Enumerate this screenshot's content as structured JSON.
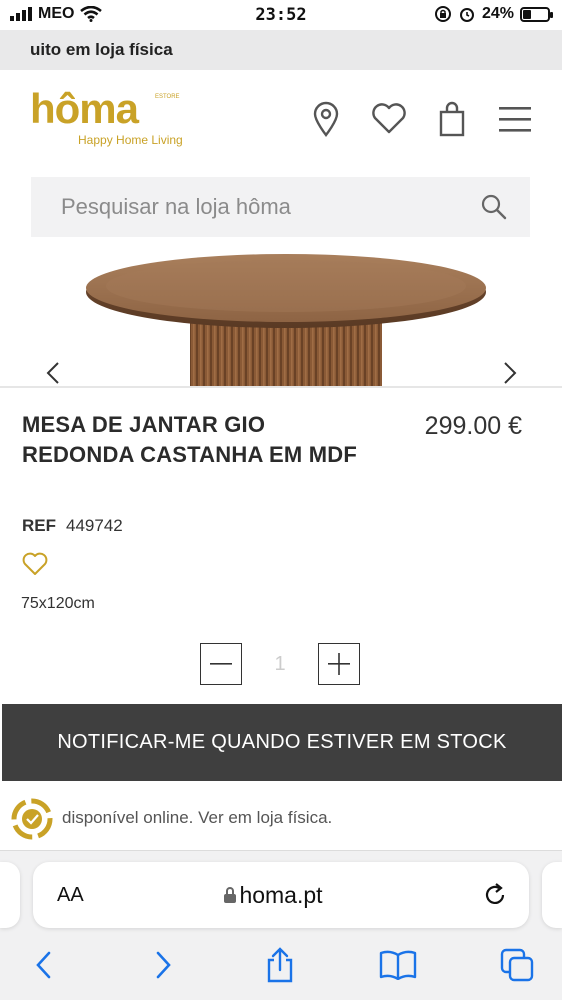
{
  "status_bar": {
    "carrier": "MEO",
    "time": "23:52",
    "battery": "24%"
  },
  "banner": {
    "text": "uito em loja física"
  },
  "header": {
    "logo_text": "hôma",
    "logo_small": "ESTORE",
    "logo_tagline": "Happy Home Living",
    "icons": [
      "location-pin-icon",
      "heart-icon",
      "shopping-bag-icon",
      "hamburger-menu-icon"
    ]
  },
  "search": {
    "placeholder": "Pesquisar na loja hôma"
  },
  "product": {
    "title": "MESA DE JANTAR GIO REDONDA CASTANHA EM MDF",
    "price": "299.00 €",
    "ref_label": "REF",
    "ref_value": "449742",
    "dimensions": "75x120cm",
    "quantity": "1"
  },
  "notify_button": {
    "label": "NOTIFICAR-ME QUANDO ESTIVER EM STOCK"
  },
  "availability": {
    "text": "disponível online. Ver em loja física."
  },
  "browser": {
    "aa_label": "AA",
    "url": "homa.pt"
  },
  "colors": {
    "brand_gold": "#c9a227",
    "button_dark": "#3f3f3f",
    "ios_blue": "#1a73e8"
  }
}
